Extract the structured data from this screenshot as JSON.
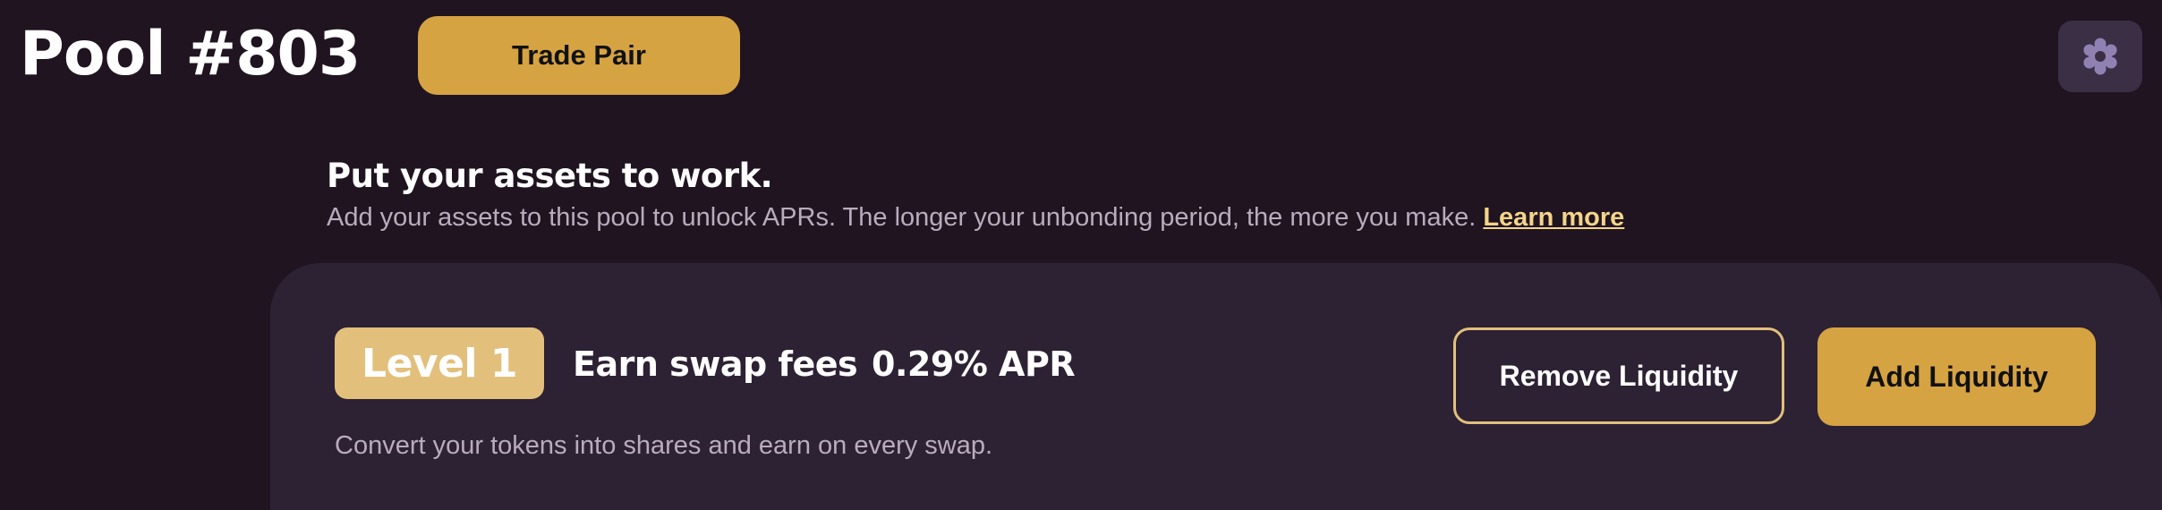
{
  "header": {
    "title": "Pool #803",
    "trade_button_label": "Trade Pair",
    "settings_icon": "gear-icon"
  },
  "intro": {
    "heading": "Put your assets to work.",
    "description": "Add your assets to this pool to unlock APRs. The longer your unbonding period, the more you make.",
    "learn_more_label": "Learn more"
  },
  "level_card": {
    "badge_label": "Level 1",
    "title": "Earn swap fees",
    "apr": "0.29% APR",
    "description": "Convert your tokens into shares and earn on every swap.",
    "remove_button_label": "Remove Liquidity",
    "add_button_label": "Add Liquidity"
  },
  "colors": {
    "background": "#1f1420",
    "card": "#2d2134",
    "accent": "#d6a343",
    "badge": "#e2c07c",
    "link": "#f4d48a",
    "muted_text": "#b9acbd",
    "settings_bg": "#3a2f44",
    "settings_icon": "#8f82b3"
  }
}
